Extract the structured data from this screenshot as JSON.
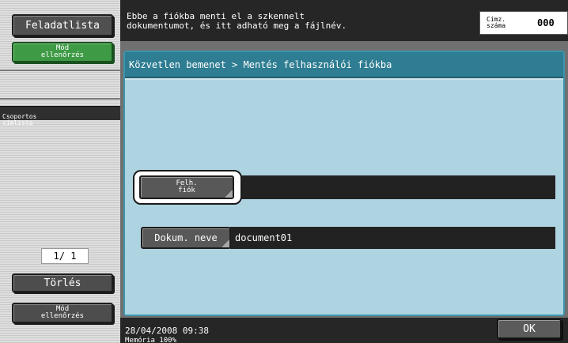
{
  "sidebar": {
    "job_list_label": "Feladatlista",
    "mode_check_top_label": "Mód\nellenőrzés",
    "group_list_heading": "Csoportos\ncímlista",
    "page_counter": "1/  1",
    "delete_label": "Törlés",
    "mode_check_bottom_label": "Mód\nellenőrzés"
  },
  "header": {
    "message": "Ebbe a fiókba menti el a szkennelt\ndokumentumot, és itt adható meg a fájlnév.",
    "destination_label": "Címz.\nszáma",
    "destination_count": "000"
  },
  "main": {
    "breadcrumb": "Közvetlen bemenet > Mentés felhasználói fiókba",
    "user_box_label": "Felh.\nfiók",
    "user_box_value": "",
    "doc_name_label": "Dokum. neve",
    "doc_name_value": "document01"
  },
  "footer": {
    "datetime": "28/04/2008   09:38",
    "memory": "Memória     100%",
    "ok_label": "OK"
  },
  "colors": {
    "panel_accent": "#2e7d92",
    "panel_background": "#aed3e1",
    "mode_check_green": "#3f9a45"
  }
}
